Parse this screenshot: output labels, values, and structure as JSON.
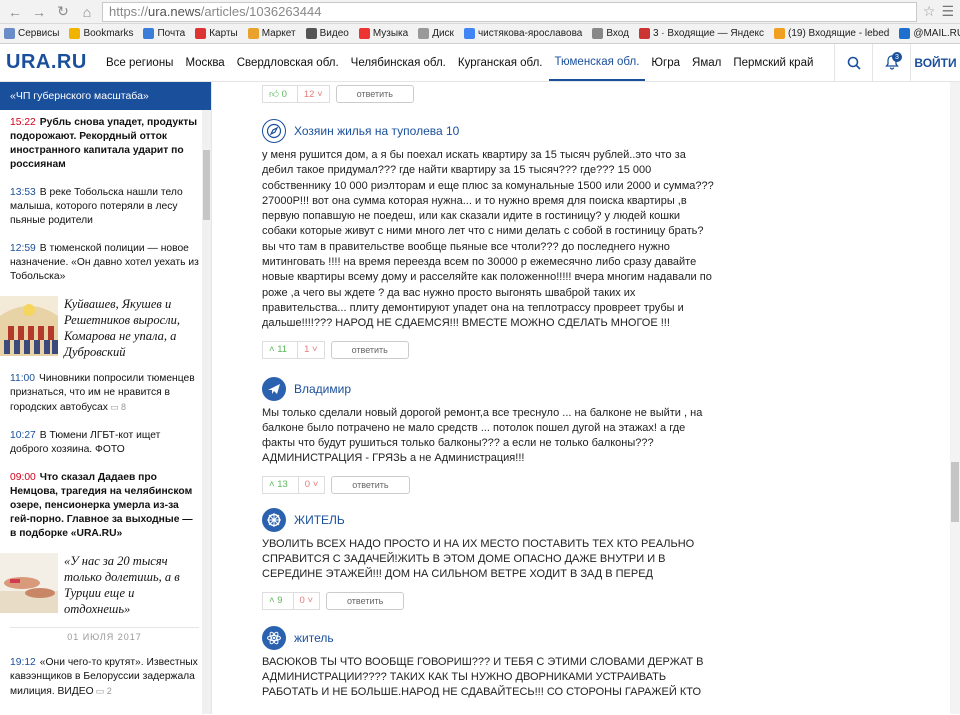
{
  "browser": {
    "url_proto": "https://",
    "url_host": "ura.news",
    "url_path": "/articles/1036263444",
    "bookmarks": [
      {
        "label": "Сервисы",
        "color": "#6a8cc7"
      },
      {
        "label": "Bookmarks",
        "color": "#f0b400"
      },
      {
        "label": "Почта",
        "color": "#3b7dd8"
      },
      {
        "label": "Карты",
        "color": "#d33"
      },
      {
        "label": "Маркет",
        "color": "#e9a22c"
      },
      {
        "label": "Видео",
        "color": "#555"
      },
      {
        "label": "Музыка",
        "color": "#e33"
      },
      {
        "label": "Диск",
        "color": "#999"
      },
      {
        "label": "чистякова-ярославова",
        "color": "#4285f4"
      },
      {
        "label": "Вход",
        "color": "#888"
      },
      {
        "label": "3 · Входящие — Яндекс",
        "color": "#c33"
      },
      {
        "label": "(19) Входящие - lebed",
        "color": "#f0a020"
      },
      {
        "label": "@MAIL.RU: почта, пои",
        "color": "#1f6fce"
      }
    ]
  },
  "header": {
    "logo": "URA.RU",
    "regions": [
      "Все регионы",
      "Москва",
      "Свердловская обл.",
      "Челябинская обл.",
      "Курганская обл.",
      "Тюменская обл.",
      "Югра",
      "Ямал",
      "Пермский край"
    ],
    "active_region_index": 5,
    "bell_count": "3",
    "login": "ВОЙТИ"
  },
  "sidebar": {
    "top_label": "«ЧП губернского масштаба»",
    "items": [
      {
        "time": "15:22",
        "red": true,
        "bold": true,
        "text": "Рубль снова упадет, продукты подорожают. Рекордный отток иностранного капитала ударит по россиянам",
        "comments": ""
      },
      {
        "time": "13:53",
        "red": false,
        "bold": false,
        "text": "В реке Тобольска нашли тело малыша, которого потеряли в лесу пьяные родители",
        "comments": ""
      },
      {
        "time": "12:59",
        "red": false,
        "bold": false,
        "text": "В тюменской полиции — новое назначение. «Он давно хотел уехать из Тобольска»",
        "comments": ""
      }
    ],
    "photo1_text": "Куйвашев, Якушев и Решетников выросли, Комарова не упала, а Дубровский",
    "items2": [
      {
        "time": "11:00",
        "red": false,
        "bold": false,
        "text": "Чиновники попросили тюменцев признаться, что им не нравится в городских автобусах",
        "comments": "8"
      },
      {
        "time": "10:27",
        "red": false,
        "bold": false,
        "text": "В Тюмени ЛГБТ-кот ищет доброго хозяина. ФОТО",
        "comments": ""
      },
      {
        "time": "09:00",
        "red": true,
        "bold": true,
        "text": "Что сказал Дадаев про Немцова, трагедия на челябинском озере, пенсионерка умерла из-за гей-порно. Главное за выходные — в подборке «URA.RU»",
        "comments": ""
      }
    ],
    "photo2_text": "«У нас за 20 тысяч только долетишь, а в Турции еще и отдохнешь»",
    "date_divider": "01 ИЮЛЯ 2017",
    "items3": [
      {
        "time": "19:12",
        "red": false,
        "bold": false,
        "text": "«Они чего-то крутят». Известных кавээнщиков в Белоруссии задержала милиция. ВИДЕО",
        "comments": "2"
      }
    ]
  },
  "comments": {
    "reply_label": "ответить",
    "top_votes": {
      "up": "0",
      "down": "12"
    },
    "list": [
      {
        "author": "Хозяин жилья на туполева 10",
        "avatar": "compass-icon",
        "text": "у меня рушится дом, а я бы поехал искать квартиру за 15 тысяч рублей..это что за дебил такое придумал??? где найти квартиру за 15 тысяч??? где??? 15 000 собственнику 10 000 риэлторам и еще плюс за комунальные 1500 или 2000 и сумма??? 27000Р!!! вот она сумма которая нужна... и то нужно время для поиска квартиры ,в первую попавшую не поедеш, или как сказали идите в гостиницу? у людей кошки собаки которые живут с ними много лет что с ними делать с собой в гостиницу брать? вы что там в правительстве вообще пьяные все чтоли??? до последнего нужно митинговать !!!! на время переезда всем по 30000 р ежемесячно либо сразу давайте новые квартиры всему дому и расселяйте как положенно!!!!! вчера многим надавали по роже ,а чего вы ждете ? да вас нужно просто выгонять шваброй таких их правительства... плиту демонтируют упадет она на теплотрассу провреет трубы и дальше!!!!??? НАРОД НЕ СДАЕМСЯ!!! ВМЕСТЕ МОЖНО СДЕЛАТЬ МНОГОЕ !!!",
        "up": "11",
        "down": "1"
      },
      {
        "author": "Владимир",
        "avatar": "airplane-icon",
        "text": "Мы только сделали новый дорогой ремонт,а все треснуло ... на балконе не выйти , на балконе было потрачено не мало средств ... потолок пошел дугой на этажах! а где факты что будут рушиться только балконы??? а если не только балконы??? АДМИНИСТРАЦИЯ - ГРЯЗЬ а не Администрация!!!",
        "up": "13",
        "down": "0"
      },
      {
        "author": "ЖИТЕЛЬ",
        "avatar": "wheel-icon",
        "text": "УВОЛИТЬ ВСЕХ НАДО ПРОСТО И НА ИХ МЕСТО ПОСТАВИТЬ ТЕХ КТО РЕАЛЬНО СПРАВИТСЯ С ЗАДАЧЕЙ!ЖИТЬ В ЭТОМ ДОМЕ ОПАСНО ДАЖЕ ВНУТРИ И В СЕРЕДИНЕ ЭТАЖЕЙ!!! ДОМ НА СИЛЬНОМ ВЕТРЕ ХОДИТ В ЗАД В ПЕРЕД",
        "up": "9",
        "down": "0"
      },
      {
        "author": "житель",
        "avatar": "atom-icon",
        "text": "ВАСЮКОВ ТЫ ЧТО ВООБЩЕ ГОВОРИШ??? И ТЕБЯ С ЭТИМИ СЛОВАМИ ДЕРЖАТ В АДМИНИСТРАЦИИ???? ТАКИХ КАК ТЫ НУЖНО ДВОРНИКАМИ УСТРАИВАТЬ РАБОТАТЬ И НЕ БОЛЬШЕ.НАРОД НЕ СДАВАЙТЕСЬ!!! СО СТОРОНЫ ГАРАЖЕЙ КТО",
        "up": "",
        "down": ""
      }
    ]
  }
}
